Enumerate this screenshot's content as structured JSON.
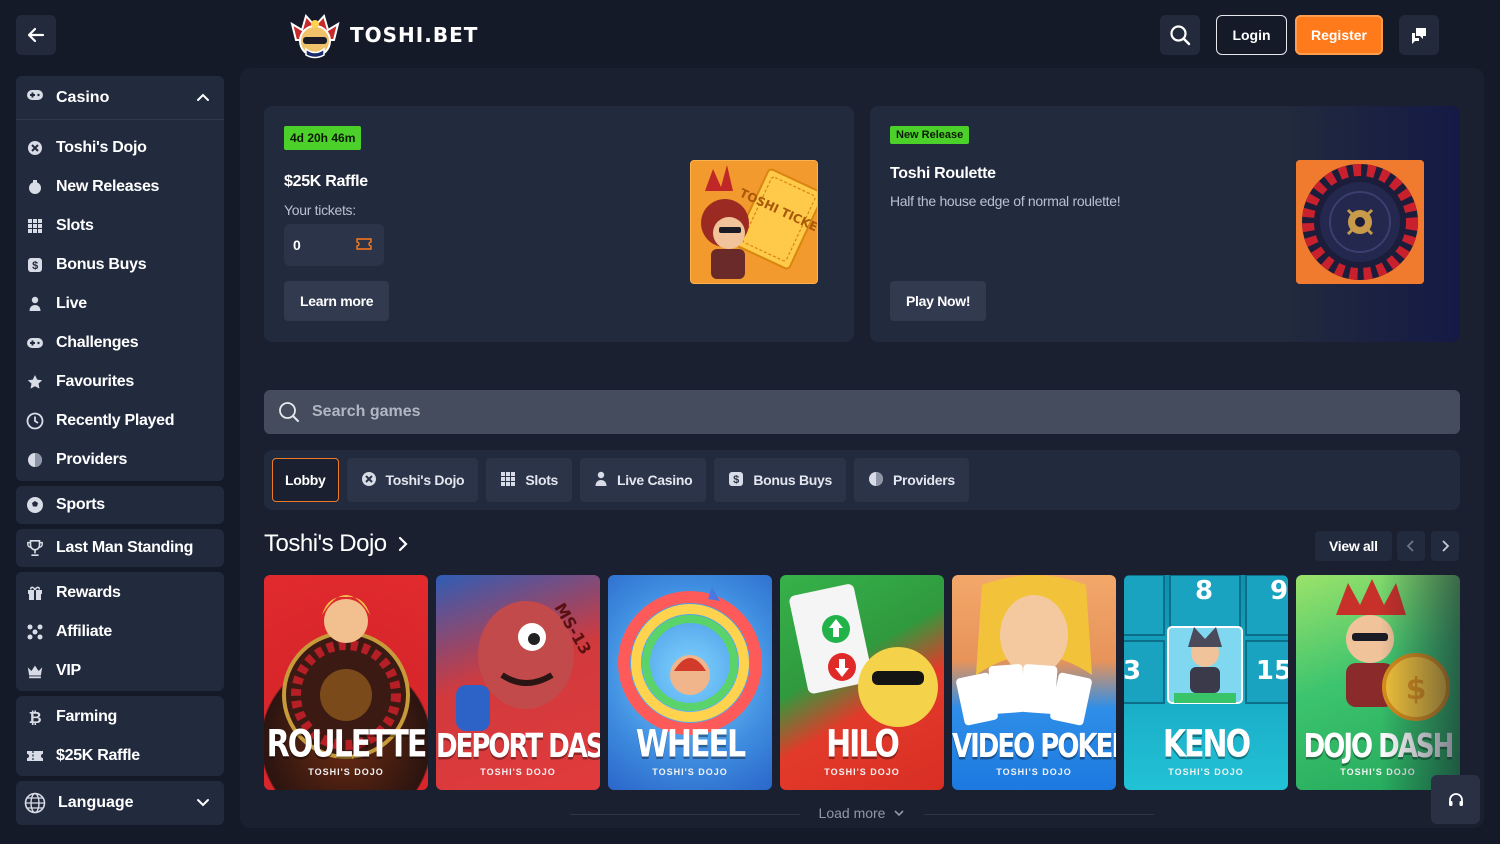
{
  "header": {
    "logo_text": "TOSHI.BET",
    "login_label": "Login",
    "register_label": "Register",
    "accent_color": "#ff7a1a"
  },
  "sidebar": {
    "casino_label": "Casino",
    "casino_items": [
      {
        "label": "Toshi's Dojo",
        "icon": "dojo-icon"
      },
      {
        "label": "New Releases",
        "icon": "new-icon"
      },
      {
        "label": "Slots",
        "icon": "grid-icon"
      },
      {
        "label": "Bonus Buys",
        "icon": "dollar-icon"
      },
      {
        "label": "Live",
        "icon": "person-icon"
      },
      {
        "label": "Challenges",
        "icon": "gamepad-icon"
      },
      {
        "label": "Favourites",
        "icon": "star-icon"
      },
      {
        "label": "Recently Played",
        "icon": "clock-icon"
      },
      {
        "label": "Providers",
        "icon": "provider-icon"
      }
    ],
    "sports_label": "Sports",
    "lms_label": "Last Man Standing",
    "rewards_label": "Rewards",
    "affiliate_label": "Affiliate",
    "vip_label": "VIP",
    "farming_label": "Farming",
    "raffle_label": "$25K Raffle",
    "language_label": "Language"
  },
  "promo1": {
    "badge": "4d 20h 46m",
    "title": "$25K Raffle",
    "subtitle": "Your tickets:",
    "tickets": "0",
    "button": "Learn more",
    "art_text": "TOSHI TICKET"
  },
  "promo2": {
    "badge": "New Release",
    "title": "Toshi Roulette",
    "subtitle": "Half the house edge of normal roulette!",
    "button": "Play Now!"
  },
  "search": {
    "placeholder": "Search games"
  },
  "tabs": [
    {
      "label": "Lobby",
      "active": true
    },
    {
      "label": "Toshi's Dojo",
      "icon": "dojo-icon"
    },
    {
      "label": "Slots",
      "icon": "grid-icon"
    },
    {
      "label": "Live Casino",
      "icon": "person-icon"
    },
    {
      "label": "Bonus Buys",
      "icon": "dollar-icon"
    },
    {
      "label": "Providers",
      "icon": "provider-icon"
    }
  ],
  "section": {
    "title": "Toshi's Dojo",
    "view_all": "View all",
    "load_more": "Load more"
  },
  "games": [
    {
      "title": "ROULETTE",
      "studio": "TOSHI'S DOJO",
      "bg": "#d8262b"
    },
    {
      "title": "DEPORT DASH",
      "studio": "TOSHI'S DOJO",
      "bg": "#e0353e"
    },
    {
      "title": "WHEEL",
      "studio": "TOSHI'S DOJO",
      "bg": "#2a66c9"
    },
    {
      "title": "HILO",
      "studio": "TOSHI'S DOJO",
      "bg": "#e23a2a"
    },
    {
      "title": "VIDEO POKER",
      "studio": "TOSHI'S DOJO",
      "bg": "#1c79e0"
    },
    {
      "title": "KENO",
      "studio": "TOSHI'S DOJO",
      "bg": "#18a9c4"
    },
    {
      "title": "DOJO DASH",
      "studio": "TOSHI'S DOJO",
      "bg": "#27b968"
    }
  ]
}
